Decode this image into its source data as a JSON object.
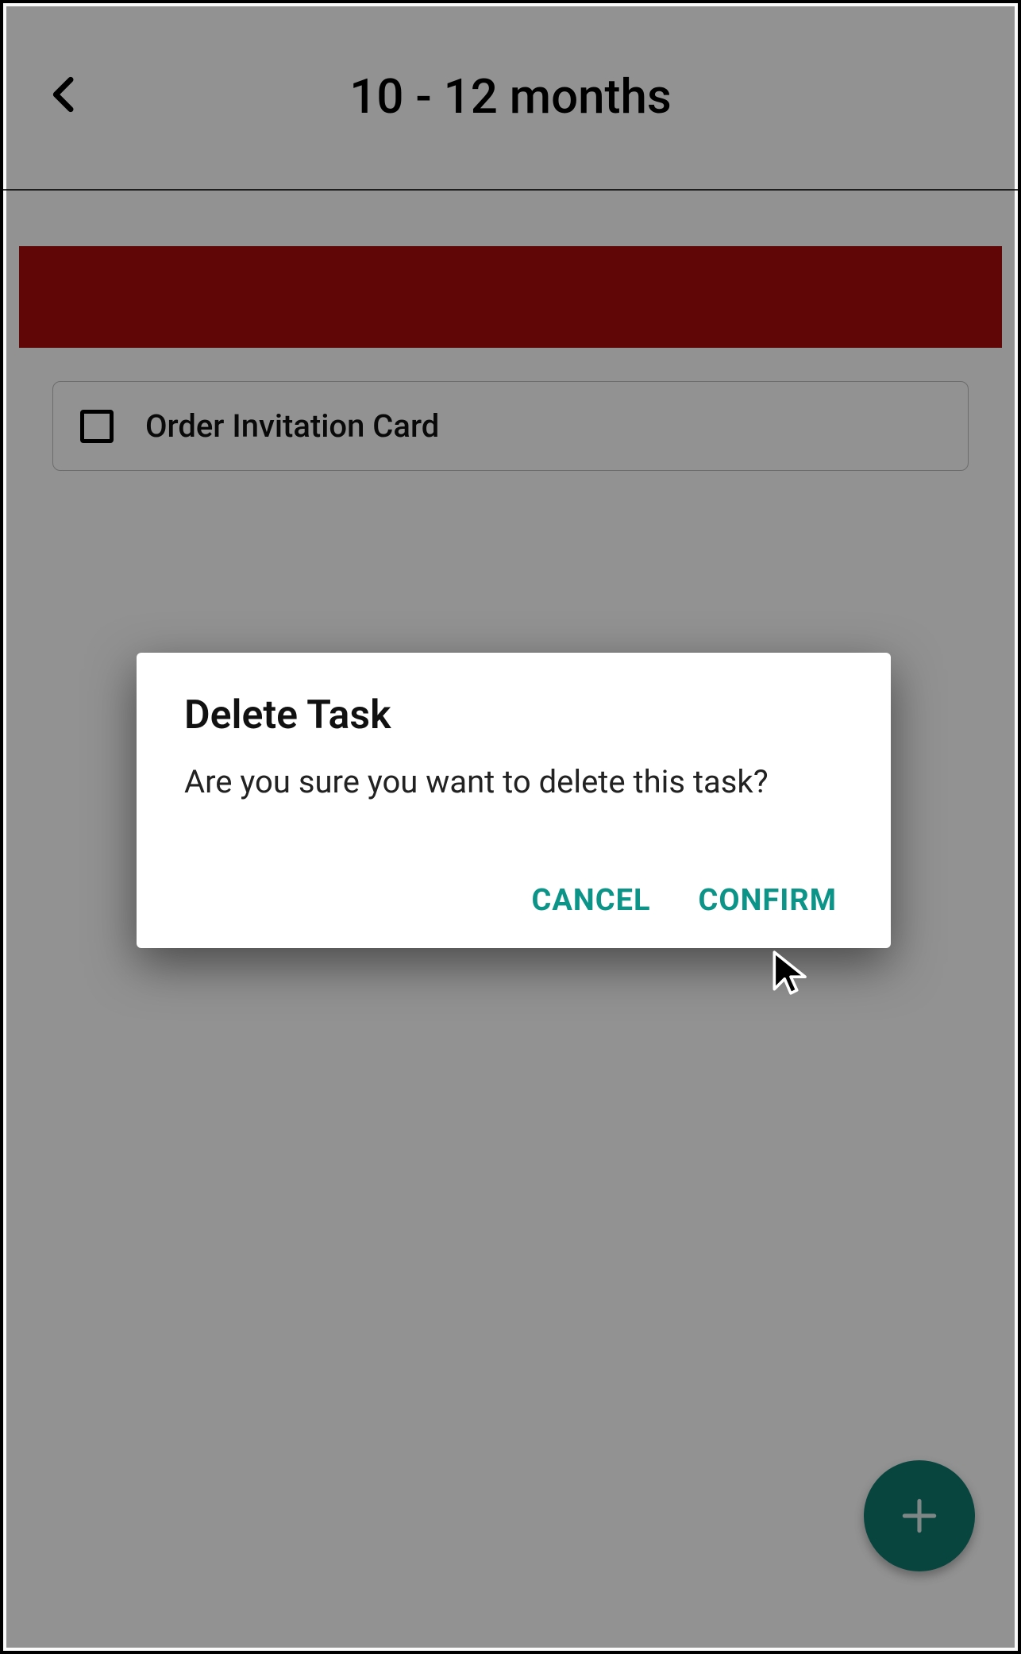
{
  "header": {
    "title": "10 - 12 months"
  },
  "tasks": [
    {
      "label": "Order Invitation Card",
      "checked": false
    }
  ],
  "dialog": {
    "title": "Delete Task",
    "message": "Are you sure you want to delete this task?",
    "cancel_label": "CANCEL",
    "confirm_label": "CONFIRM"
  },
  "colors": {
    "banner": "#a60c0c",
    "accent": "#0d9488",
    "fab": "#0d776b"
  }
}
